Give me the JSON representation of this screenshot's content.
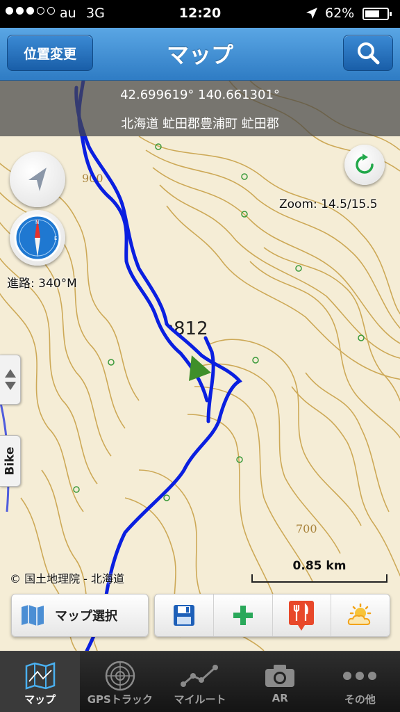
{
  "status_bar": {
    "carrier": "au",
    "network": "3G",
    "time": "12:20",
    "battery": "62%",
    "signal_bars_filled": 3,
    "signal_bars_total": 5
  },
  "nav": {
    "left_button": "位置変更",
    "title": "マップ",
    "right_icon": "search-icon"
  },
  "map": {
    "coordinates": "42.699619° 140.661301°",
    "address": "北海道 虻田郡豊浦町 虻田郡",
    "zoom": "Zoom: 14.5/15.5",
    "heading": "進路: 340°M",
    "side_tab": "Bike",
    "copyright": "© 国土地理院 - 北海道",
    "scale": "0.85 km",
    "elevation_labels": [
      "900",
      "812",
      "700"
    ]
  },
  "toolbar": {
    "map_select": "マップ選択",
    "tools": [
      "save-icon",
      "plus-icon",
      "restaurant-icon",
      "weather-icon"
    ]
  },
  "tabs": [
    {
      "label": "マップ",
      "icon": "map-icon",
      "active": true
    },
    {
      "label": "GPSトラック",
      "icon": "radar-icon",
      "active": false
    },
    {
      "label": "マイルート",
      "icon": "route-icon",
      "active": false
    },
    {
      "label": "AR",
      "icon": "camera-icon",
      "active": false
    },
    {
      "label": "その他",
      "icon": "more-icon",
      "active": false
    }
  ],
  "colors": {
    "nav_blue": "#2f7cc4",
    "track_blue": "#0a1fe0",
    "contour": "#c9a24a",
    "map_bg": "#f5edd6",
    "save_blue": "#1d5fb8",
    "plus_green": "#2aa85a",
    "food_red": "#e8482a",
    "weather_orange": "#f2a31a"
  }
}
